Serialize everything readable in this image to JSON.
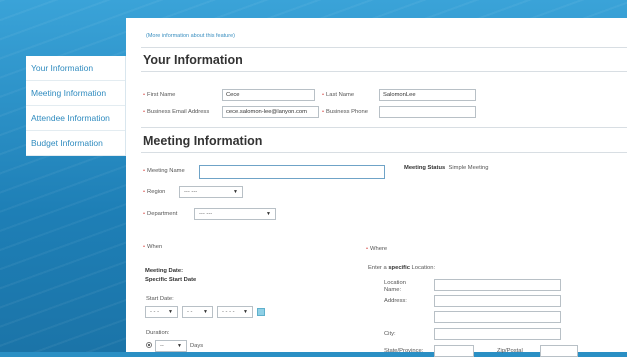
{
  "info_link": "(More information about this feature)",
  "sidebar": {
    "items": [
      {
        "label": "Your Information"
      },
      {
        "label": "Meeting Information"
      },
      {
        "label": "Attendee Information"
      },
      {
        "label": "Budget Information"
      }
    ]
  },
  "your_info": {
    "heading": "Your Information",
    "first_name_label": "First Name",
    "first_name_value": "Cece",
    "last_name_label": "Last Name",
    "last_name_value": "SalomonLee",
    "email_label": "Business Email Address",
    "email_value": "cece.salomon-lee@lanyon.com",
    "phone_label": "Business Phone",
    "phone_value": ""
  },
  "meeting": {
    "heading": "Meeting Information",
    "name_label": "Meeting Name",
    "name_value": "",
    "status_label": "Meeting Status",
    "status_value": "Simple Meeting",
    "region_label": "Region",
    "region_value": "--- ---",
    "department_label": "Department",
    "department_value": "--- ---",
    "when_label": "When",
    "meeting_date_label": "Meeting Date:",
    "specific_start_label": "Specific Start Date",
    "start_date_label": "Start Date:",
    "start_month": "- - -",
    "start_day": "- -",
    "start_year": "- - - -",
    "duration_label": "Duration:",
    "duration_value": "--",
    "days_label": "Days",
    "where_label": "Where",
    "enter_location_prefix": "Enter a",
    "enter_location_bold": "specific",
    "enter_location_suffix": "Location:",
    "location_name_label": "Location Name:",
    "address_label": "Address:",
    "city_label": "City:",
    "state_label": "State/Province:",
    "zip_label": "Zip/Postal"
  },
  "colors": {
    "link": "#2f8bbf",
    "required": "#d9534f",
    "background": "#2a8fc4"
  }
}
